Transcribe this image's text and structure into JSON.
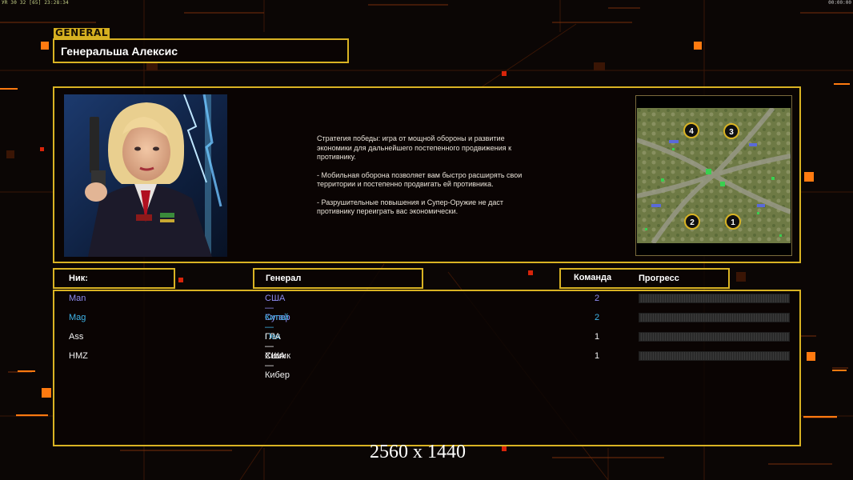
{
  "status_bar": {
    "left": "УR 30 32 [65] 23:28:34",
    "right": "00:00:00"
  },
  "header": {
    "tag": "GENERAL",
    "general_name": "Генеральша Алексис"
  },
  "description": {
    "lines": [
      "Стратегия победы: игра от мощной обороны и развитие\n экономики для дальнейшего постепенного продвижения к\n противнику.",
      "- Мобильная оборона позволяет вам быстро расширять свои\n территории и постепенно продвигать ей противника.",
      "- Разрушительные повышения и Супер-Оружие не даст\n противнику переиграть вас экономически."
    ]
  },
  "map": {
    "start_positions": [
      "4",
      "3",
      "2",
      "1"
    ]
  },
  "columns": {
    "nick": "Ник:",
    "general": "Генерал",
    "team": "Команда",
    "progress": "Прогресс"
  },
  "players": [
    {
      "nick": "Man",
      "general": "США — Супер",
      "team": "2",
      "color": "#8e8cf0"
    },
    {
      "nick": "Mag",
      "general": "Китай — Пех",
      "team": "2",
      "color": "#3fb4e8"
    },
    {
      "nick": "Ass",
      "general": "ГЛА — Химик",
      "team": "1",
      "color": "#f0f0f0"
    },
    {
      "nick": "HMZ",
      "general": "США — Кибер",
      "team": "1",
      "color": "#f0f0f0"
    }
  ],
  "watermark": "2560 x 1440",
  "colors": {
    "frame": "#d9b323",
    "accent_orange": "#ff6a10"
  }
}
